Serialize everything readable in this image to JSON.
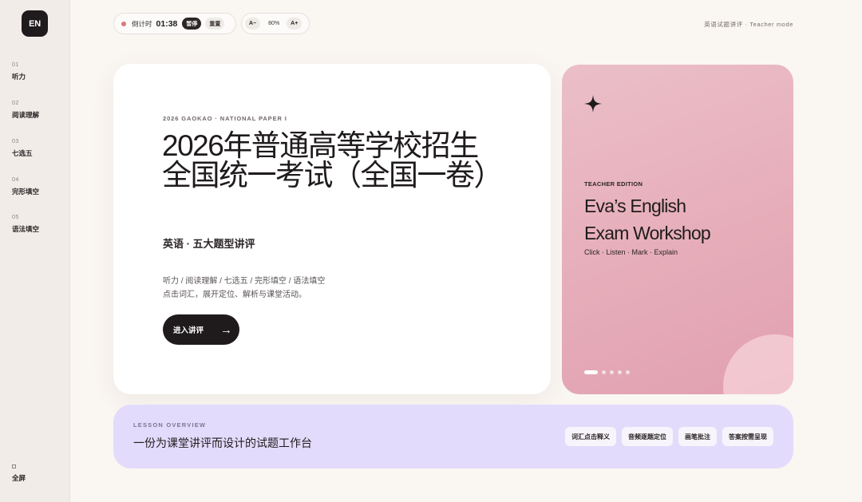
{
  "logo": "EN",
  "sidebar": {
    "items": [
      {
        "num": "01",
        "label": "听力"
      },
      {
        "num": "02",
        "label": "阅读理解"
      },
      {
        "num": "03",
        "label": "七选五"
      },
      {
        "num": "04",
        "label": "完形填空"
      },
      {
        "num": "05",
        "label": "语法填空"
      }
    ],
    "fullscreen_label": "全屏"
  },
  "timer": {
    "label": "倒计时",
    "value": "01:38",
    "pause_label": "暂停",
    "reset_label": "重置"
  },
  "zoom": {
    "decrease_label": "A−",
    "value": "80%",
    "increase_label": "A+"
  },
  "mode_label": "英语试题讲评 · Teacher mode",
  "hero": {
    "kicker": "2026 GAOKAO · NATIONAL PAPER I",
    "title": "2026年普通高等学校招生全国统一考试（全国一卷）",
    "subtitle": "英语 · 五大题型讲评",
    "desc_line1": "听力 / 阅读理解 / 七选五 / 完形填空 / 语法填空",
    "desc_line2": "点击词汇，展开定位、解析与课堂活动。",
    "cta_label": "进入讲评",
    "cta_arrow": "→"
  },
  "feature": {
    "kicker": "TEACHER EDITION",
    "title_line1": "Eva’s English",
    "title_line2": "Exam Workshop",
    "tagline": "Click · Listen · Mark · Explain",
    "slide_count": 5,
    "active_slide": 1,
    "accent": "#e6adb9"
  },
  "overview": {
    "kicker": "LESSON OVERVIEW",
    "title": "一份为课堂讲评而设计的试题工作台",
    "chips": [
      "词汇点击释义",
      "音频逐题定位",
      "画笔批注",
      "答案按需呈现"
    ],
    "accent": "#e3dbfb"
  }
}
